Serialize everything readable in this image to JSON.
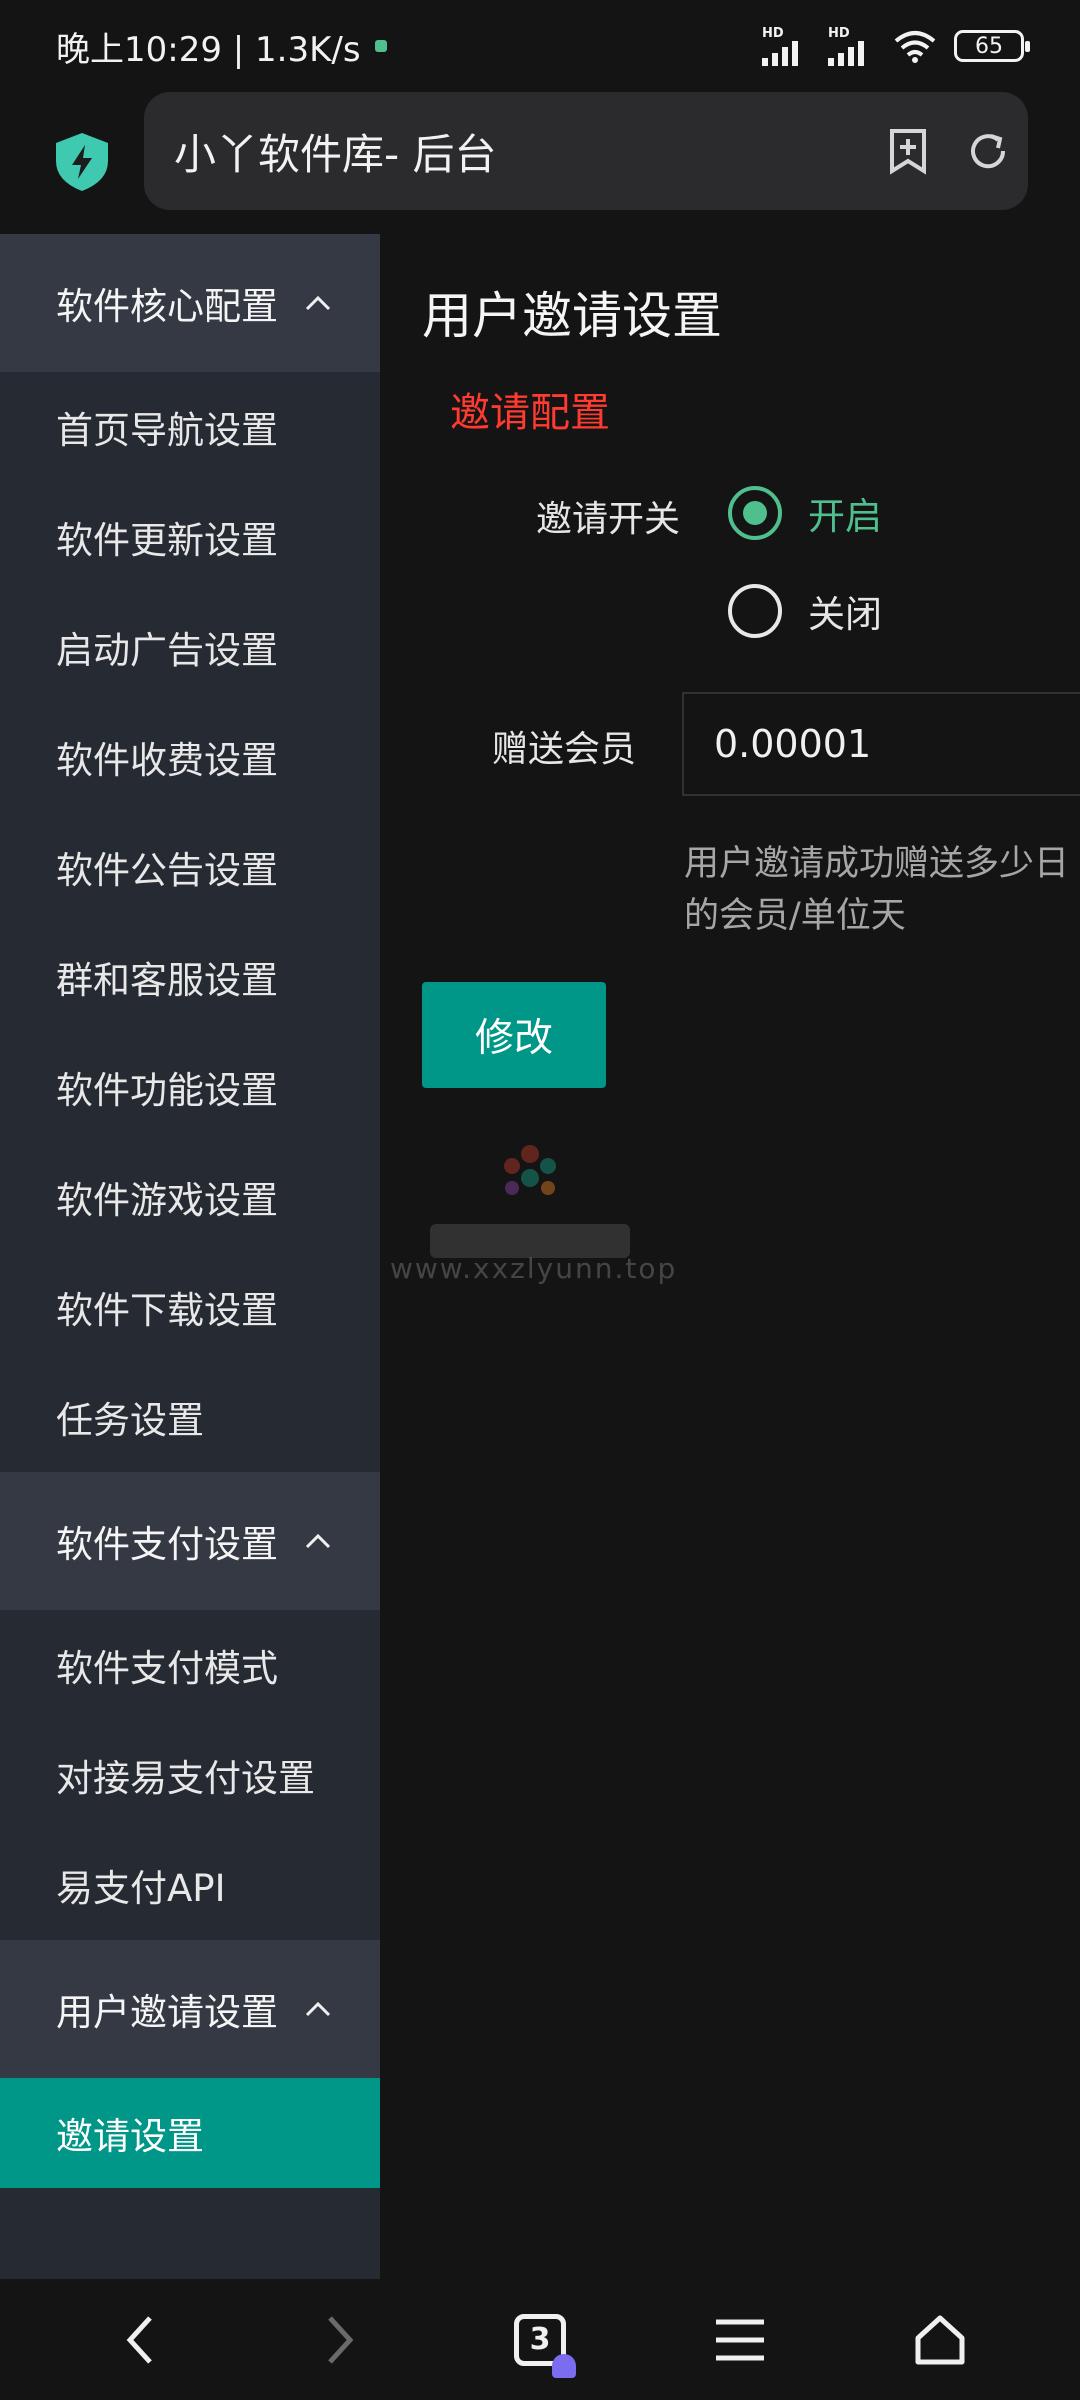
{
  "status_bar": {
    "time_speed": "晚上10:29 | 1.3K/s",
    "signal1_label": "HD",
    "signal2_label": "HD",
    "battery": "65"
  },
  "browser": {
    "url_title": "小丫软件库- 后台"
  },
  "sidebar": {
    "groups": [
      {
        "label": "软件核心配置",
        "items": [
          {
            "label": "首页导航设置"
          },
          {
            "label": "软件更新设置"
          },
          {
            "label": "启动广告设置"
          },
          {
            "label": "软件收费设置"
          },
          {
            "label": "软件公告设置"
          },
          {
            "label": "群和客服设置"
          },
          {
            "label": "软件功能设置"
          },
          {
            "label": "软件游戏设置"
          },
          {
            "label": "软件下载设置"
          },
          {
            "label": "任务设置"
          }
        ]
      },
      {
        "label": "软件支付设置",
        "items": [
          {
            "label": "软件支付模式"
          },
          {
            "label": "对接易支付设置"
          },
          {
            "label": "易支付API"
          }
        ]
      },
      {
        "label": "用户邀请设置",
        "items": [
          {
            "label": "邀请设置",
            "active": true
          }
        ]
      }
    ]
  },
  "main": {
    "page_title": "用户邀请设置",
    "section_title": "邀请配置",
    "invite_switch": {
      "label": "邀请开关",
      "options": [
        "开启",
        "关闭"
      ],
      "selected": "开启"
    },
    "gift_member": {
      "label": "赠送会员",
      "value": "0.00001",
      "help_line1": "用户邀请成功赠送多少日",
      "help_line2": "的会员/单位天"
    },
    "submit_label": "修改"
  },
  "watermark": {
    "text": "www.xxzlyunn.top"
  },
  "colors": {
    "accent": "#009688",
    "radio_on": "#4fc08d",
    "section_title": "#ff3b2f",
    "sidebar_bg": "#262a33",
    "group_header_bg": "#343944"
  }
}
